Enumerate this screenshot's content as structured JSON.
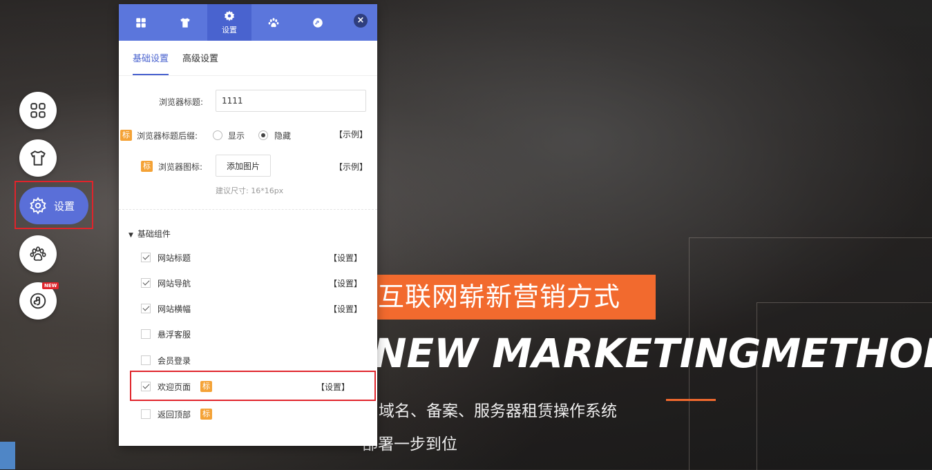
{
  "hero": {
    "tag": "互联网崭新营销方式",
    "english": "NEW MARKETINGMETHOD",
    "sub1": "域名、备案、服务器租赁操作系统",
    "sub2": "部署一步到位"
  },
  "sidebar": {
    "items": [
      {
        "icon": "grid-icon"
      },
      {
        "icon": "shirt-icon"
      },
      {
        "icon": "gear-icon",
        "label": "设置"
      },
      {
        "icon": "paw-icon"
      },
      {
        "icon": "miniprogram-icon",
        "badge": "NEW"
      }
    ]
  },
  "panel": {
    "tabs": [
      {
        "icon": "grid-icon"
      },
      {
        "icon": "shirt-icon"
      },
      {
        "icon": "gear-icon",
        "label": "设置"
      },
      {
        "icon": "paw-icon"
      },
      {
        "icon": "miniprogram-icon"
      }
    ],
    "close": "×",
    "subtabs": [
      "基础设置",
      "高级设置"
    ],
    "browser_title_label": "浏览器标题:",
    "browser_title_value": "1111",
    "suffix_tag": "标",
    "suffix_label": "浏览器标题后缀:",
    "radio_show": "显示",
    "radio_hide": "隐藏",
    "example": "【示例】",
    "icon_tag": "标",
    "icon_label": "浏览器图标:",
    "add_image": "添加图片",
    "size_hint": "建议尺寸: 16*16px",
    "section_title": "基础组件",
    "set_label": "【设置】",
    "components": [
      {
        "label": "网站标题",
        "checked": true
      },
      {
        "label": "网站导航",
        "checked": true
      },
      {
        "label": "网站横幅",
        "checked": true
      },
      {
        "label": "悬浮客服",
        "checked": false
      },
      {
        "label": "会员登录",
        "checked": false
      },
      {
        "label": "欢迎页面",
        "checked": true,
        "tag": "标"
      },
      {
        "label": "返回顶部",
        "checked": false,
        "tag": "标"
      }
    ]
  }
}
